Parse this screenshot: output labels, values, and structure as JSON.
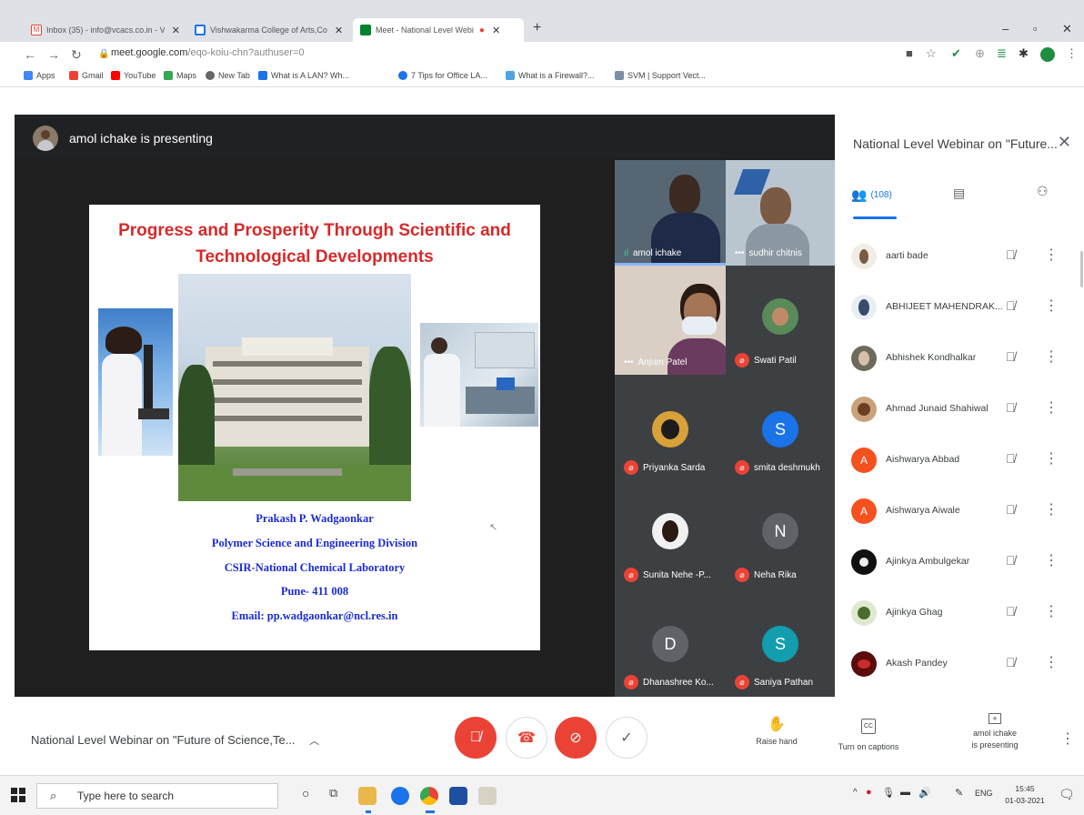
{
  "browser": {
    "tabs": [
      {
        "label": "Inbox (35) - info@vcacs.co.in - V",
        "icon": "gmail-icon",
        "active": false
      },
      {
        "label": "Vishwakarma College of Arts,Co",
        "icon": "doc-icon",
        "active": false
      },
      {
        "label": "Meet - National Level Webi",
        "icon": "meet-icon",
        "active": true
      }
    ],
    "new_tab": "+",
    "url_host": "meet.google.com",
    "url_path": "/eqo-koiu-chn?authuser=0",
    "bookmarks": [
      "Apps",
      "Gmail",
      "YouTube",
      "Maps",
      "New Tab",
      "What is A LAN? Wh...",
      "7 Tips for Office LA...",
      "What is a Firewall?...",
      "SVM | Support Vect..."
    ]
  },
  "meet": {
    "presenter_text": "amol ichake is presenting",
    "slide": {
      "title_line1": "Progress and Prosperity Through Scientific and",
      "title_line2": "Technological Developments",
      "author": "Prakash P. Wadgaonkar",
      "division": "Polymer Science and Engineering Division",
      "lab": "CSIR-National Chemical Laboratory",
      "city": "Pune- 411 008",
      "email": "Email: pp.wadgaonkar@ncl.res.in"
    },
    "tiles": [
      {
        "name": "amol ichake"
      },
      {
        "name": "sudhir chitnis"
      },
      {
        "name": "Anjum Patel"
      },
      {
        "name": "Swati Patil"
      },
      {
        "name": "Priyanka Sarda"
      },
      {
        "name": "smita deshmukh",
        "initial": "S"
      },
      {
        "name": "Sunita Nehe -P..."
      },
      {
        "name": "Neha Rika",
        "initial": "N"
      },
      {
        "name": "Dhanashree Ko...",
        "initial": "D"
      },
      {
        "name": "Saniya Pathan",
        "initial": "S"
      }
    ],
    "panel": {
      "title": "National Level Webinar on \"Future...",
      "people_count": "(108)",
      "participants": [
        {
          "name": "aarti bade"
        },
        {
          "name": "ABHIJEET MAHENDRAK..."
        },
        {
          "name": "Abhishek Kondhalkar"
        },
        {
          "name": "Ahmad Junaid Shahiwal"
        },
        {
          "name": "Aishwarya Abbad",
          "initial": "A"
        },
        {
          "name": "Aishwarya Aiwale",
          "initial": "A"
        },
        {
          "name": "Ajinkya Ambulgekar"
        },
        {
          "name": "Ajinkya Ghag"
        },
        {
          "name": "Akash Pandey"
        }
      ]
    },
    "bottom": {
      "meeting_title": "National Level Webinar on \"Future of Science,Te...",
      "raise_hand": "Raise hand",
      "captions": "Turn on captions",
      "captions_icon_text": "CC",
      "presenting_line1": "amol ichake",
      "presenting_line2": "is presenting"
    }
  },
  "taskbar": {
    "search_placeholder": "Type here to search",
    "lang": "ENG",
    "time": "15:45",
    "date": "01-03-2021"
  },
  "colors": {
    "meet_red": "#ea4335",
    "orange_avatar": "#f4511e",
    "teal_avatar": "#129eaf",
    "grey_tile": "#3c4043"
  }
}
